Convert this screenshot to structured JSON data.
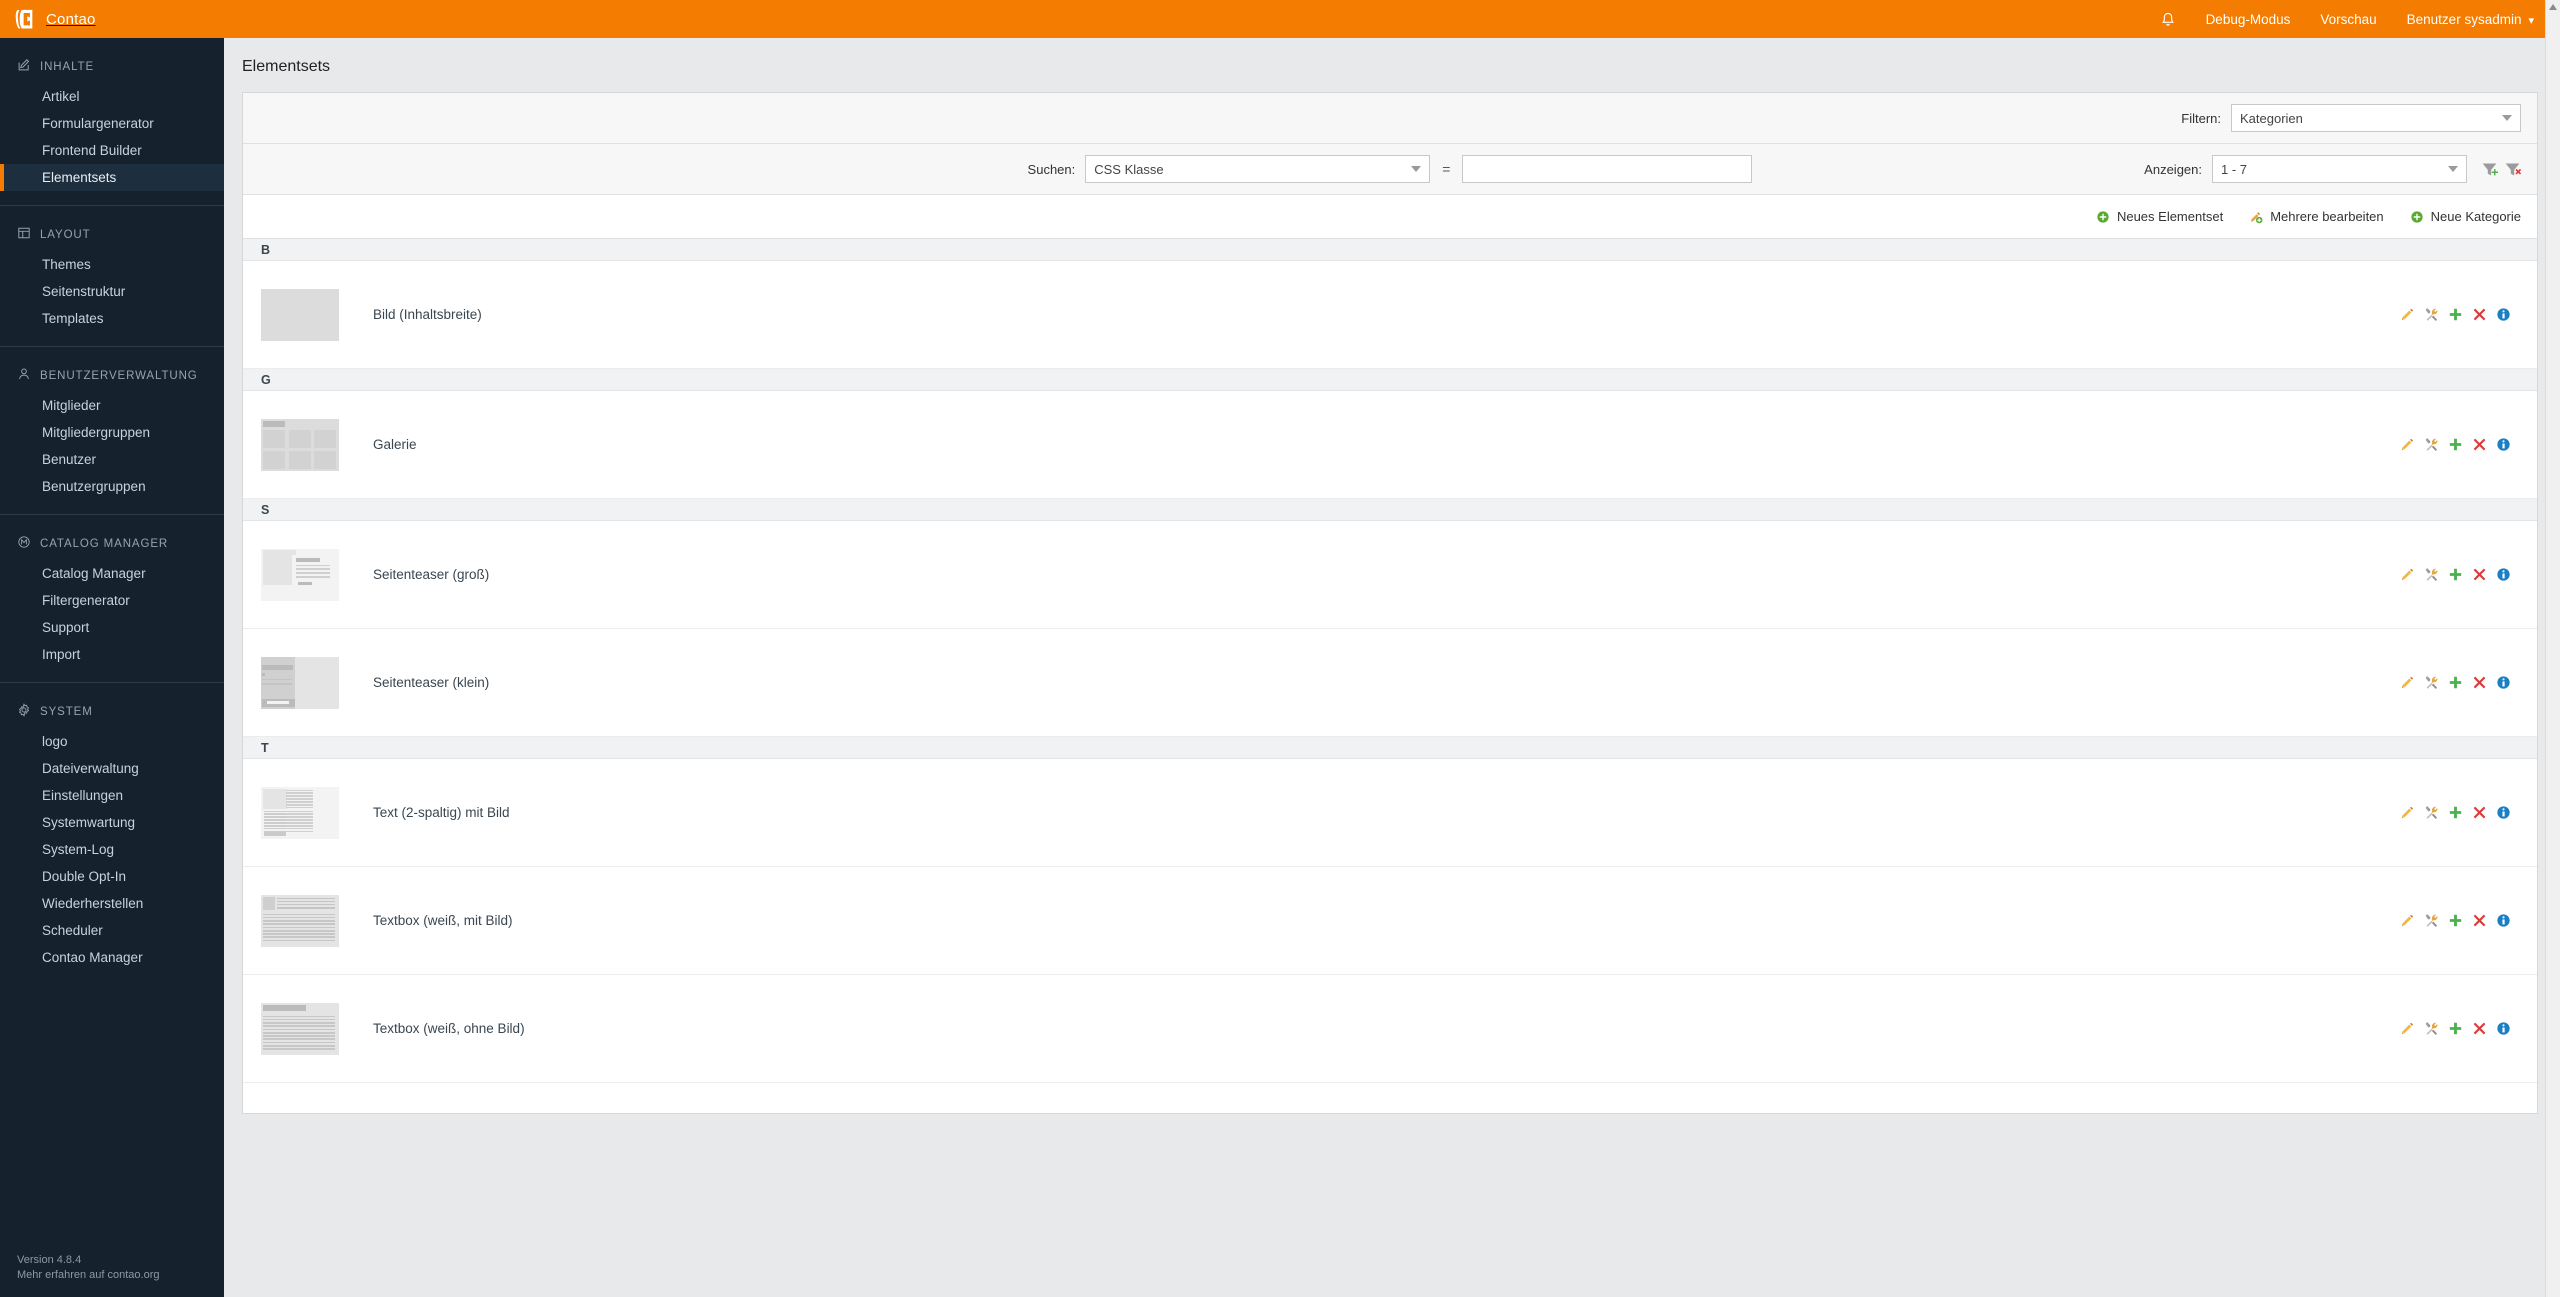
{
  "topbar": {
    "brand": "Contao",
    "brand_logo_icon": "contao-logo-icon",
    "bell_icon": "bell-icon",
    "links": [
      {
        "label": "Debug-Modus",
        "name": "debug-mode-link"
      },
      {
        "label": "Vorschau",
        "name": "preview-link"
      }
    ],
    "user_menu": "Benutzer sysadmin",
    "user_caret": "⌄"
  },
  "sidebar": {
    "groups": [
      {
        "title": "INHALTE",
        "icon": "pencil-square-icon",
        "items": [
          {
            "label": "Artikel",
            "active": false
          },
          {
            "label": "Formulargenerator",
            "active": false
          },
          {
            "label": "Frontend Builder",
            "active": false
          },
          {
            "label": "Elementsets",
            "active": true
          }
        ]
      },
      {
        "title": "LAYOUT",
        "icon": "layout-grid-icon",
        "items": [
          {
            "label": "Themes",
            "active": false
          },
          {
            "label": "Seitenstruktur",
            "active": false
          },
          {
            "label": "Templates",
            "active": false
          }
        ]
      },
      {
        "title": "BENUTZERVERWALTUNG",
        "icon": "user-icon",
        "items": [
          {
            "label": "Mitglieder",
            "active": false
          },
          {
            "label": "Mitgliedergruppen",
            "active": false
          },
          {
            "label": "Benutzer",
            "active": false
          },
          {
            "label": "Benutzergruppen",
            "active": false
          }
        ]
      },
      {
        "title": "CATALOG MANAGER",
        "icon": "circle-m-icon",
        "items": [
          {
            "label": "Catalog Manager",
            "active": false
          },
          {
            "label": "Filtergenerator",
            "active": false
          },
          {
            "label": "Support",
            "active": false
          },
          {
            "label": "Import",
            "active": false
          }
        ]
      },
      {
        "title": "SYSTEM",
        "icon": "gear-icon",
        "items": [
          {
            "label": "logo",
            "active": false
          },
          {
            "label": "Dateiverwaltung",
            "active": false
          },
          {
            "label": "Einstellungen",
            "active": false
          },
          {
            "label": "Systemwartung",
            "active": false
          },
          {
            "label": "System-Log",
            "active": false
          },
          {
            "label": "Double Opt-In",
            "active": false
          },
          {
            "label": "Wiederherstellen",
            "active": false
          },
          {
            "label": "Scheduler",
            "active": false
          },
          {
            "label": "Contao Manager",
            "active": false
          }
        ]
      }
    ],
    "footer": {
      "version": "Version 4.8.4",
      "more": "Mehr erfahren auf contao.org"
    }
  },
  "main": {
    "page_title": "Elementsets",
    "filter": {
      "label": "Filtern:",
      "value": "Kategorien"
    },
    "search": {
      "label": "Suchen:",
      "field_value": "CSS Klasse",
      "operator": "=",
      "input_value": "",
      "input_placeholder": ""
    },
    "display": {
      "label": "Anzeigen:",
      "value": "1 - 7",
      "apply_filter_icon": "filter-add-icon",
      "clear_filter_icon": "filter-remove-icon"
    },
    "actions": [
      {
        "label": "Neues Elementset",
        "icon": "plus-circle-icon",
        "name": "new-elementset-button"
      },
      {
        "label": "Mehrere bearbeiten",
        "icon": "edit-multiple-icon",
        "name": "edit-multiple-button"
      },
      {
        "label": "Neue Kategorie",
        "icon": "plus-circle-icon",
        "name": "new-category-button"
      }
    ],
    "row_action_icons": [
      {
        "name": "edit-icon",
        "title": "Bearbeiten"
      },
      {
        "name": "edit-settings-icon",
        "title": "Einstellungen"
      },
      {
        "name": "copy-icon",
        "title": "Kopieren"
      },
      {
        "name": "delete-icon",
        "title": "Löschen"
      },
      {
        "name": "info-icon",
        "title": "Info"
      }
    ],
    "groups": [
      {
        "letter": "B",
        "rows": [
          {
            "label": "Bild (Inhaltsbreite)",
            "thumb": "image-full"
          }
        ]
      },
      {
        "letter": "G",
        "rows": [
          {
            "label": "Galerie",
            "thumb": "gallery-grid"
          }
        ]
      },
      {
        "letter": "S",
        "rows": [
          {
            "label": "Seitenteaser (groß)",
            "thumb": "teaser-large"
          },
          {
            "label": "Seitenteaser (klein)",
            "thumb": "teaser-small"
          }
        ]
      },
      {
        "letter": "T",
        "rows": [
          {
            "label": "Text (2-spaltig) mit Bild",
            "thumb": "text-two-col"
          },
          {
            "label": "Textbox (weiß, mit Bild)",
            "thumb": "textbox-image"
          },
          {
            "label": "Textbox (weiß, ohne Bild)",
            "thumb": "textbox-plain"
          }
        ]
      }
    ]
  },
  "colors": {
    "brand_orange": "#f47c00",
    "sidebar_bg": "#15222e",
    "sidebar_active_bg": "#1d2f3f",
    "main_bg": "#e8e9ea",
    "edit_icon": "#e8a33d",
    "add_icon": "#4caf50",
    "delete_icon": "#d93a3a",
    "info_icon": "#1b7fc4"
  }
}
